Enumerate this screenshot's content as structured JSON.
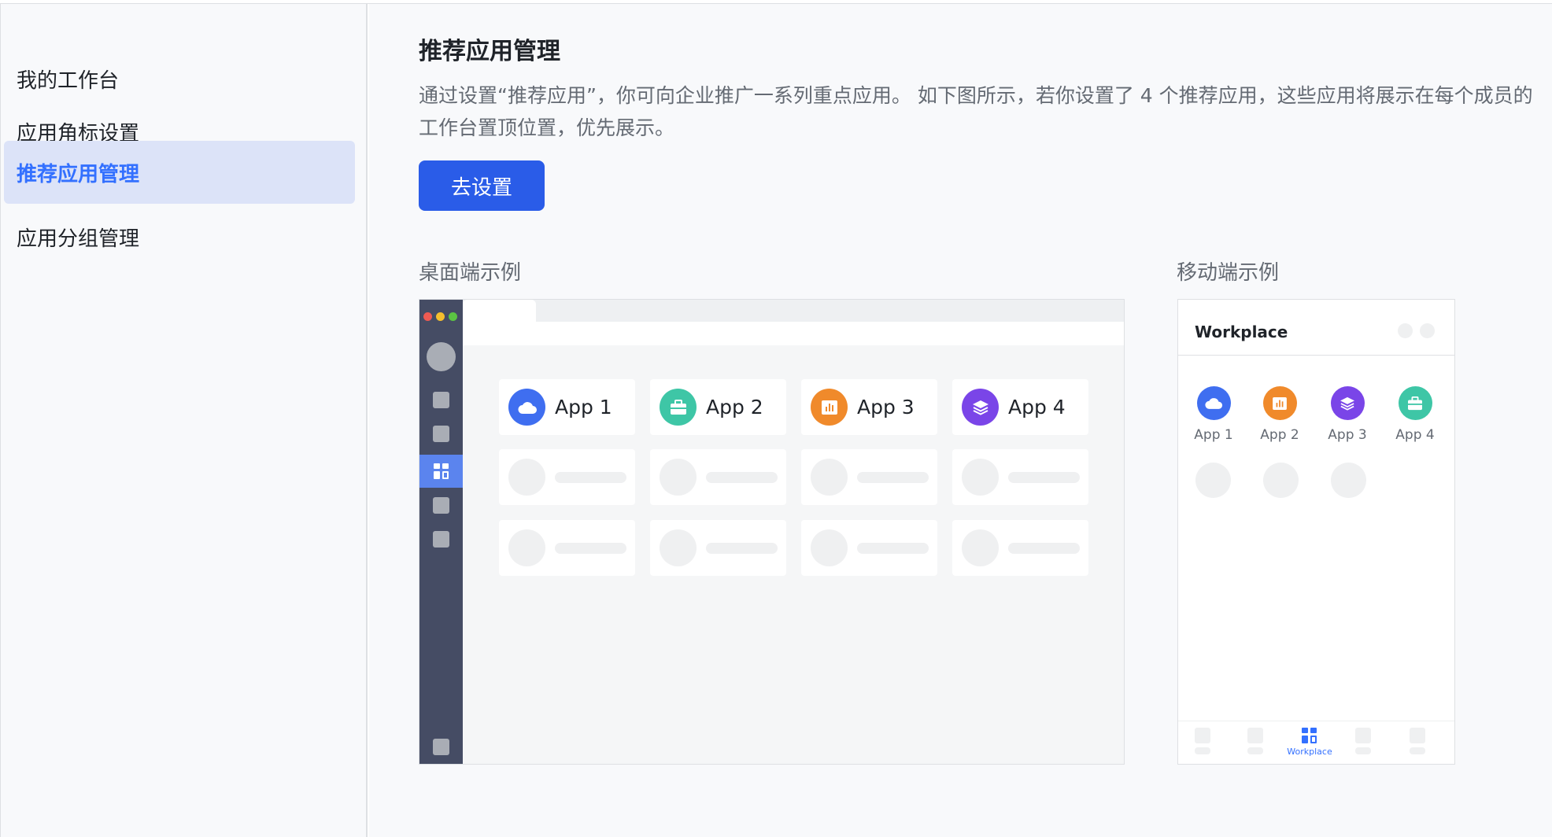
{
  "sidebar": {
    "items": [
      {
        "label": "我的工作台"
      },
      {
        "label": "应用角标设置"
      },
      {
        "label": "推荐应用管理",
        "active": true
      },
      {
        "label": "应用分组管理"
      }
    ]
  },
  "main": {
    "title": "推荐应用管理",
    "description": "通过设置“推荐应用”，你可向企业推广一系列重点应用。 如下图所示，若你设置了 4 个推荐应用，这些应用将展示在每个成员的工作台置顶位置，优先展示。",
    "action_button": "去设置",
    "desktop_label": "桌面端示例",
    "mobile_label": "移动端示例"
  },
  "apps": [
    {
      "label": "App 1",
      "icon": "cloud-icon",
      "color": "#3f6ef0"
    },
    {
      "label": "App 2",
      "icon": "briefcase-icon",
      "color": "#3ec6a6"
    },
    {
      "label": "App 3",
      "icon": "chart-icon",
      "color": "#f08a2b"
    },
    {
      "label": "App 4",
      "icon": "layers-icon",
      "color": "#7a45e8"
    }
  ],
  "mobile": {
    "title": "Workplace",
    "apps": [
      {
        "label": "App 1",
        "icon": "cloud-icon",
        "color": "#3f6ef0"
      },
      {
        "label": "App 2",
        "icon": "chart-icon",
        "color": "#f08a2b"
      },
      {
        "label": "App 3",
        "icon": "layers-icon",
        "color": "#7a45e8"
      },
      {
        "label": "App 4",
        "icon": "briefcase-icon",
        "color": "#3ec6a6"
      }
    ],
    "active_tab_label": "Workplace"
  },
  "colors": {
    "primary": "#2a5ce8",
    "accent": "#3370ff",
    "sidebar_active_bg": "#dce3f8",
    "desktop_rail": "#454c64"
  }
}
